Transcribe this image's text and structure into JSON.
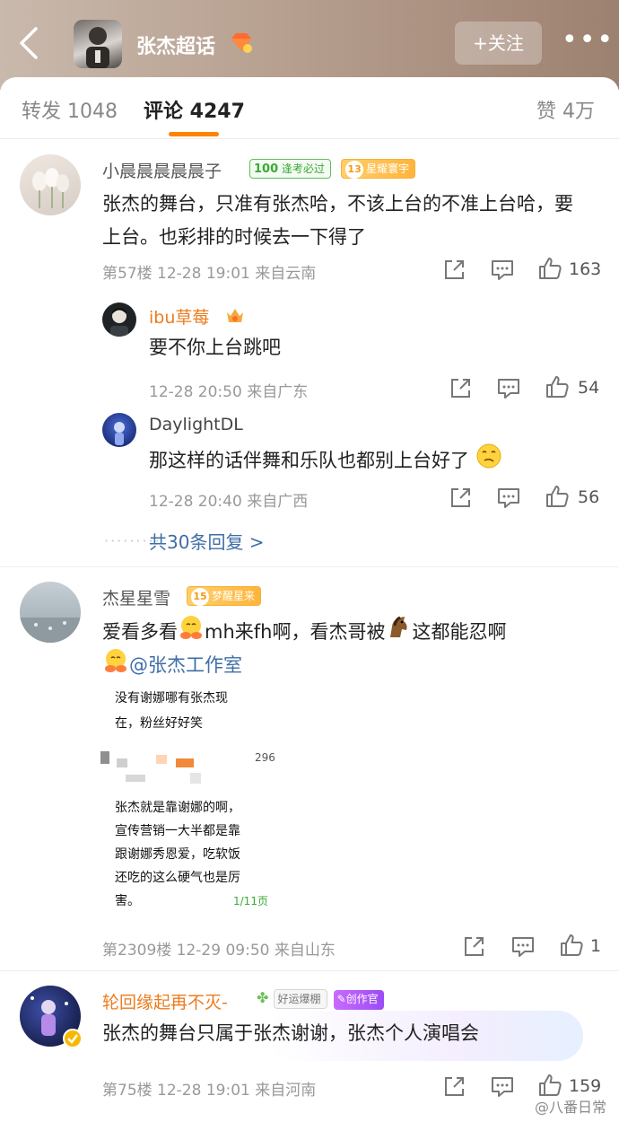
{
  "header": {
    "topic_title": "张杰超话",
    "follow_label": "+关注",
    "more_label": "•••"
  },
  "tabs": {
    "repost": "转发 1048",
    "comments": "评论 4247",
    "likes": "赞 4万"
  },
  "comments": [
    {
      "username": "小晨晨晨晨晨子",
      "badges": [
        "逢考必过",
        "星耀寰宇"
      ],
      "badge_level": "13",
      "text": "张杰的舞台，只准有张杰哈，不该上台的不准上台哈，要上台。也彩排的时候去一下得了",
      "meta": "第57楼  12-28 19:01  来自云南",
      "likes": "163",
      "replies": [
        {
          "username": "ibu草莓",
          "text": "要不你上台跳吧",
          "meta": "12-28 20:50  来自广东",
          "likes": "54"
        },
        {
          "username": "DaylightDL",
          "text": "那这样的话伴舞和乐队也都别上台好了",
          "meta": "12-28 20:40  来自广西",
          "likes": "56"
        }
      ],
      "more_replies": "共30条回复 >"
    },
    {
      "username": "杰星星雪",
      "badges": [
        "梦醒星来"
      ],
      "badge_level": "15",
      "text_part1": "爱看多看",
      "text_part2": "mh来fh啊，看杰哥被",
      "text_part3": "这都能忍啊",
      "mention": "@张杰工作室",
      "embedded": {
        "line1": "没有谢娜哪有张杰现",
        "line2": "在，粉丝好好笑",
        "count": "296",
        "body1": "张杰就是靠谢娜的啊，",
        "body2": "宣传营销一大半都是靠",
        "body3": "跟谢娜秀恩爱，吃软饭",
        "body4": "还吃的这么硬气也是厉",
        "body5": "害。",
        "page": "1/11页"
      },
      "meta": "第2309楼  12-29 09:50  来自山东",
      "likes": "1"
    },
    {
      "username": "轮回缘起再不灭-",
      "badges": [
        "好运爆棚",
        "创作官"
      ],
      "text": "张杰的舞台只属于张杰谢谢，张杰个人演唱会",
      "meta": "第75楼  12-28 19:01  来自河南",
      "likes": "159"
    }
  ],
  "watermark": "@八番日常",
  "colors": {
    "accent": "#ff8200",
    "link": "#3f6ea6",
    "vip_name": "#ec7c1e"
  }
}
